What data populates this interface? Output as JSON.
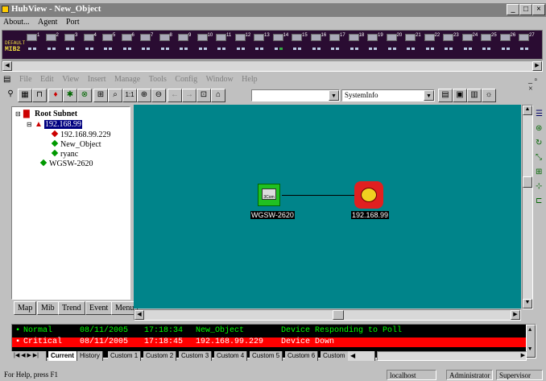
{
  "hub": {
    "title": "HubView - New_Object",
    "menu": [
      "About...",
      "Agent",
      "Port"
    ],
    "panel_label_1": "DEFAULT",
    "panel_label_2": "MIB2",
    "ports": [
      "1",
      "2",
      "3",
      "4",
      "5",
      "6",
      "7",
      "8",
      "9",
      "10",
      "11",
      "12",
      "13",
      "14",
      "15",
      "16",
      "17",
      "18",
      "19",
      "20",
      "21",
      "22",
      "23",
      "24",
      "25",
      "26",
      "27"
    ],
    "caption_buttons": [
      "_",
      "□",
      "×"
    ]
  },
  "mdi_menu": [
    "File",
    "Edit",
    "View",
    "Insert",
    "Manage",
    "Tools",
    "Config",
    "Window",
    "Help"
  ],
  "toolbar": {
    "combo1_value": "",
    "combo2_value": "SystemInfo"
  },
  "tree": {
    "root": "Root Subnet",
    "subnet": "192.168.99",
    "items": [
      "192.168.99.229",
      "New_Object",
      "ryanc"
    ],
    "switch": "WGSW-2620"
  },
  "left_tabs": [
    "Map",
    "Mib",
    "Trend",
    "Event",
    "Menu"
  ],
  "map": {
    "node_switch_label": "WGSW-2620",
    "node_switch_icon_text": "3Com",
    "node_subnet_label": "192.168.99"
  },
  "events": [
    {
      "severity": "Normal",
      "date": "08/11/2005",
      "time": "17:18:34",
      "object": "New_Object",
      "message": "Device Responding to Poll"
    },
    {
      "severity": "Critical",
      "date": "08/11/2005",
      "time": "17:18:45",
      "object": "192.168.99.229",
      "message": "Device Down"
    }
  ],
  "event_tabs": [
    "Current",
    "History",
    "Custom 1",
    "Custom 2",
    "Custom 3",
    "Custom 4",
    "Custom 5",
    "Custom 6",
    "Custom"
  ],
  "status": {
    "help": "For Help, press F1",
    "host": "localhost",
    "user": "Administrator",
    "role": "Supervisor"
  },
  "colors": {
    "map_bg": "#00848a",
    "critical_row": "#ff0000",
    "normal_text": "#00ff00",
    "selection": "#000080"
  }
}
